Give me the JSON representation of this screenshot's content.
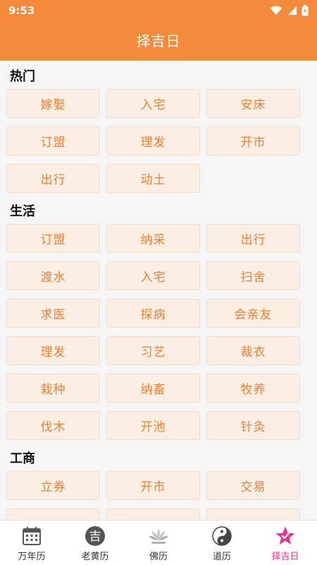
{
  "status": {
    "time": "9:53"
  },
  "header": {
    "title": "择吉日"
  },
  "sections": [
    {
      "title": "热门",
      "items": [
        "嫁娶",
        "入宅",
        "安床",
        "订盟",
        "理发",
        "开市",
        "出行",
        "动土"
      ]
    },
    {
      "title": "生活",
      "items": [
        "订盟",
        "纳采",
        "出行",
        "渡水",
        "入宅",
        "扫舍",
        "求医",
        "探病",
        "会亲友",
        "理发",
        "习艺",
        "裁衣",
        "栽种",
        "纳畜",
        "牧养",
        "伐木",
        "开池",
        "针灸"
      ]
    },
    {
      "title": "工商",
      "items": [
        "立券",
        "开市",
        "交易"
      ]
    }
  ],
  "nav": [
    {
      "label": "万年历",
      "icon": "calendar-icon"
    },
    {
      "label": "老黄历",
      "icon": "ji-icon",
      "glyph": "吉"
    },
    {
      "label": "佛历",
      "icon": "lotus-icon"
    },
    {
      "label": "道历",
      "icon": "yin-yang-icon"
    },
    {
      "label": "择吉日",
      "icon": "star-icon",
      "active": true
    }
  ],
  "colors": {
    "header": "#f58a3a",
    "tag_bg": "#fbeee3",
    "tag_text": "#ef7f32",
    "nav_active": "#e8338a"
  }
}
